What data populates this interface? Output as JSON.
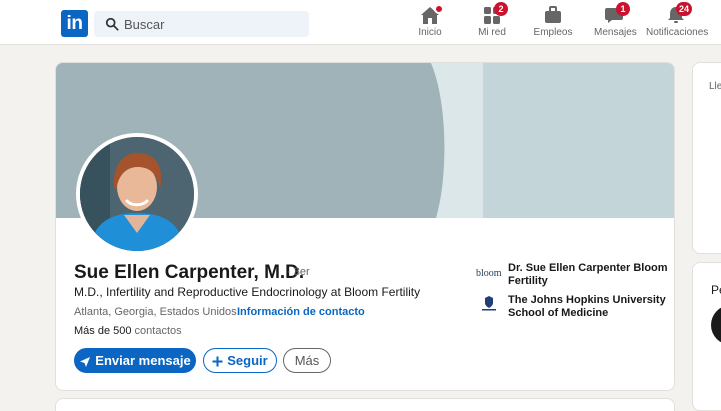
{
  "nav": {
    "search_placeholder": "Buscar",
    "items": [
      {
        "label": "Inicio",
        "icon": "home-icon",
        "badge": ""
      },
      {
        "label": "Mi red",
        "icon": "network-icon",
        "badge": "2"
      },
      {
        "label": "Empleos",
        "icon": "briefcase-icon",
        "badge": ""
      },
      {
        "label": "Mensajes",
        "icon": "messaging-icon",
        "badge": "1"
      },
      {
        "label": "Notificaciones",
        "icon": "bell-icon",
        "badge": "24"
      }
    ]
  },
  "profile": {
    "name": "Sue Ellen Carpenter, M.D.",
    "degree": "· 3er",
    "headline": "M.D., Infertility and Reproductive Endocrinology at Bloom Fertility",
    "location": "Atlanta, Georgia, Estados Unidos ·",
    "contact_link": "Información de contacto",
    "connections_count": "Más de 500",
    "connections_label": "contactos",
    "buttons": {
      "message": "Enviar mensaje",
      "follow": "Seguir",
      "more": "Más"
    },
    "orgs": [
      {
        "name": "Dr. Sue Ellen Carpenter Bloom Fertility",
        "logo_text": "bloom"
      },
      {
        "name": "The Johns Hopkins University School of Medicine",
        "logo_text": ""
      }
    ]
  },
  "side": {
    "text1": "Lle",
    "text2": "Pe"
  },
  "colors": {
    "brand": "#0a66c2",
    "badge": "#cb112d",
    "banner_dark": "#9fb3b8",
    "banner_light": "#c3d5d8"
  }
}
